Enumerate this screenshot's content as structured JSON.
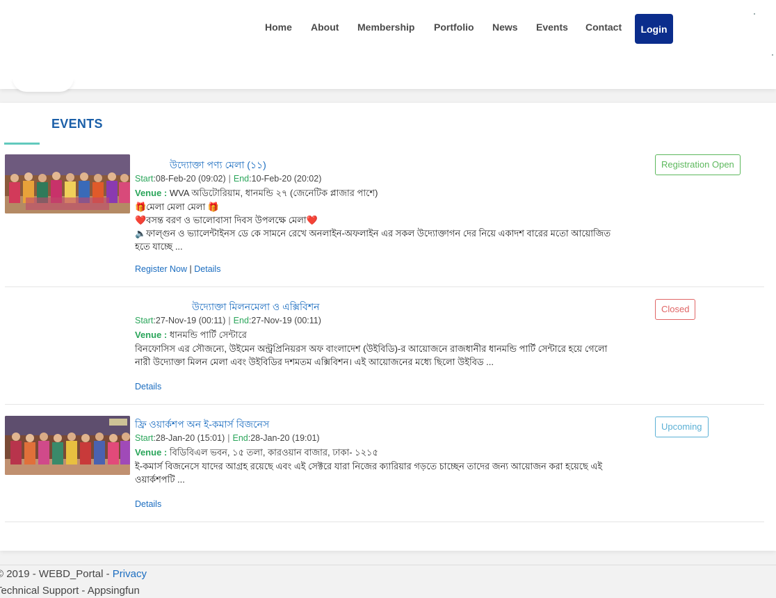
{
  "nav": {
    "items": [
      {
        "label": "Home"
      },
      {
        "label": "About"
      },
      {
        "label": "Membership"
      },
      {
        "label": "Portfolio"
      },
      {
        "label": "News"
      },
      {
        "label": "Events"
      },
      {
        "label": "Contact"
      }
    ],
    "login_label": "Login"
  },
  "events_section": {
    "title": "EVENTS",
    "events": [
      {
        "title": "উদ্যোক্তা পণ্য মেলা (১১)",
        "start_label": "Start",
        "start": ":08-Feb-20 (09:02)",
        "end_label": "End",
        "end": ":10-Feb-20 (20:02)",
        "venue_label": "Venue :",
        "venue": " WVA অডিটোরিয়াম, ধানমন্ডি ২৭ (জেনেটিক প্লাজার পাশে)",
        "desc_lines": [
          "🎁মেলা মেলা মেলা 🎁",
          "❤️বসন্ত বরণ ও ভালোবাসা দিবস উপলক্ষে মেলা❤️",
          "🔈ফাল্গুন ও ভ্যালেন্টাইনস ডে কে সামনে রেখে অনলাইন-অফলাইন এর সকল উদ্যোক্তাগন দের নিয়ে একাদশ বারের মতো আয়োজিত হতে যাচ্ছে ..."
        ],
        "register_label": "Register Now",
        "link_sep": "|",
        "details_label": "Details",
        "status": "Registration Open",
        "status_color": "#5cb85c"
      },
      {
        "title": "উদ্যোক্তা মিলনমেলা ও এক্সিবিশন",
        "start_label": "Start",
        "start": ":27-Nov-19 (00:11)",
        "end_label": "End",
        "end": ":27-Nov-19 (00:11)",
        "venue_label": "Venue :",
        "venue": " ধানমন্ডি পার্টি সেন্টারে",
        "desc_lines": [
          "বিনফোসিস এর সৌজন্যে, উইমেন অন্ট্রপ্রিনিয়রস অফ বাংলাদেশ (উইবিডি)-র আয়োজনে রাজধানীর ধানমন্ডি পার্টি সেন্টারে হয়ে গেলো নারী উদ্যোক্তা মিলন মেলা এবং উইবিডির দশমতম এক্সিবিশন। এই আয়োজনের মধ্যে ছিলো উইবিড ..."
        ],
        "details_label": "Details",
        "status": "Closed",
        "status_color": "#e06565"
      },
      {
        "title": "ফ্রি ওয়ার্কশপ অন ই-কমার্স বিজনেস",
        "start_label": "Start",
        "start": ":28-Jan-20 (15:01)",
        "end_label": "End",
        "end": ":28-Jan-20 (19:01)",
        "venue_label": "Venue :",
        "venue": " বিডিবিএল ভবন, ১৫ তলা, কারওয়ান বাজার, ঢাকা- ১২১৫",
        "desc_lines": [
          "ই-কমার্স বিজনেসে যাদের আগ্রহ রয়েছে এবং এই সেক্টরে যারা নিজের ক্যারিয়ার গড়তে চাচ্ছেন তাদের জন্য আয়োজন করা হয়েছে এই ওয়ার্কশপটি ..."
        ],
        "details_label": "Details",
        "status": "Upcoming",
        "status_color": "#5bb0d5"
      }
    ]
  },
  "footer": {
    "copyright": "© 2019 - WEBD_Portal - ",
    "privacy_label": "Privacy",
    "support": "Technical Support - Appsingfun"
  }
}
